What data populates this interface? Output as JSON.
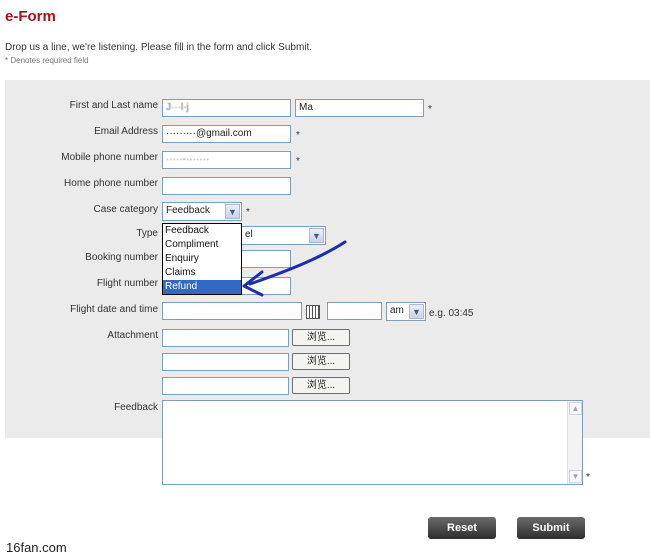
{
  "header": {
    "title": "e-Form",
    "intro": "Drop us a line, we're listening. Please fill in the form and click Submit.",
    "required_note": "* Denotes required field"
  },
  "form": {
    "required_mark": "*",
    "first_last_label": "First and Last name",
    "first_name_value": "J···l·j",
    "last_name_value": "Ma",
    "email_label": "Email Address",
    "email_value": "·········@gmail.com",
    "mobile_label": "Mobile phone number",
    "mobile_value": "·····-·······",
    "home_label": "Home phone number",
    "home_value": "",
    "case_label": "Case category",
    "case_value": "Feedback",
    "case_options": [
      "Feedback",
      "Compliment",
      "Enquiry",
      "Claims",
      "Refund"
    ],
    "type_label": "Type",
    "type_value": "el",
    "booking_label": "Booking number",
    "flight_number_label": "Flight number",
    "flight_dt_label": "Flight date and time",
    "ampm_value": "am",
    "time_hint": "e.g. 03:45",
    "attachment_label": "Attachment",
    "browse_label": "浏览...",
    "feedback_label": "Feedback"
  },
  "buttons": {
    "reset": "Reset",
    "submit": "Submit"
  },
  "watermark": "16fan.com",
  "colors": {
    "title": "#a8101e",
    "panel": "#ebebeb",
    "arrow": "#1a2fb0",
    "selected_option": "#316ac5"
  }
}
